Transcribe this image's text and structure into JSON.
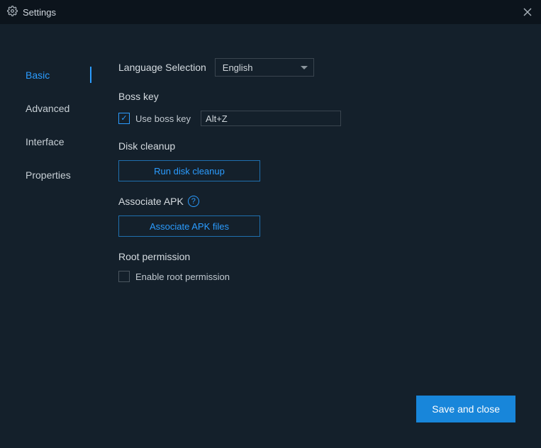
{
  "window": {
    "title": "Settings"
  },
  "sidebar": {
    "items": [
      {
        "label": "Basic",
        "active": true
      },
      {
        "label": "Advanced",
        "active": false
      },
      {
        "label": "Interface",
        "active": false
      },
      {
        "label": "Properties",
        "active": false
      }
    ]
  },
  "content": {
    "language": {
      "label": "Language Selection",
      "selected": "English"
    },
    "bosskey": {
      "section": "Boss key",
      "check_label": "Use boss key",
      "checked": true,
      "hotkey": "Alt+Z"
    },
    "diskcleanup": {
      "section": "Disk cleanup",
      "button": "Run disk cleanup"
    },
    "associate": {
      "section": "Associate APK",
      "button": "Associate APK files"
    },
    "root": {
      "section": "Root permission",
      "check_label": "Enable root permission",
      "checked": false
    }
  },
  "footer": {
    "save": "Save and close"
  }
}
